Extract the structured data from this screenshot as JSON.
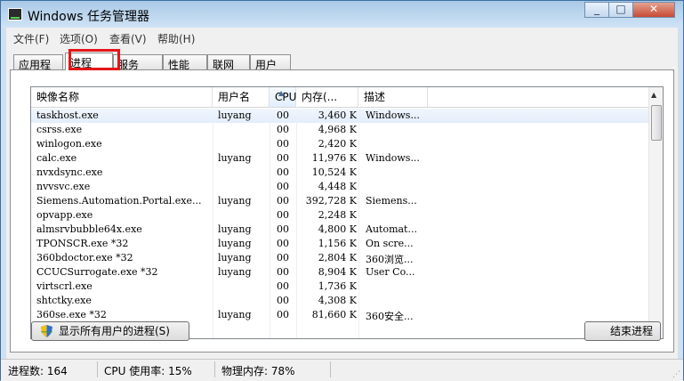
{
  "window": {
    "title": "Windows 任务管理器"
  },
  "menu": [
    "文件(F)",
    "选项(O)",
    "查看(V)",
    "帮助(H)"
  ],
  "tabs": [
    "应用程序",
    "进程",
    "服务",
    "性能",
    "联网",
    "用户"
  ],
  "active_tab": "进程",
  "columns": {
    "name": "映像名称",
    "user": "用户名",
    "cpu": "CPU",
    "mem": "内存(...",
    "desc": "描述"
  },
  "rows": [
    {
      "name": "taskhost.exe",
      "user": "luyang",
      "cpu": "00",
      "mem": "3,460 K",
      "desc": "Windows..."
    },
    {
      "name": "csrss.exe",
      "user": "",
      "cpu": "00",
      "mem": "4,968 K",
      "desc": ""
    },
    {
      "name": "winlogon.exe",
      "user": "",
      "cpu": "00",
      "mem": "2,420 K",
      "desc": ""
    },
    {
      "name": "calc.exe",
      "user": "luyang",
      "cpu": "00",
      "mem": "11,976 K",
      "desc": "Windows..."
    },
    {
      "name": "nvxdsync.exe",
      "user": "",
      "cpu": "00",
      "mem": "10,524 K",
      "desc": ""
    },
    {
      "name": "nvvsvc.exe",
      "user": "",
      "cpu": "00",
      "mem": "4,448 K",
      "desc": ""
    },
    {
      "name": "Siemens.Automation.Portal.exe...",
      "user": "luyang",
      "cpu": "00",
      "mem": "392,728 K",
      "desc": "Siemens..."
    },
    {
      "name": "opvapp.exe",
      "user": "",
      "cpu": "00",
      "mem": "2,248 K",
      "desc": ""
    },
    {
      "name": "almsrvbubble64x.exe",
      "user": "luyang",
      "cpu": "00",
      "mem": "4,800 K",
      "desc": "Automat..."
    },
    {
      "name": "TPONSCR.exe *32",
      "user": "luyang",
      "cpu": "00",
      "mem": "1,156 K",
      "desc": "On scre..."
    },
    {
      "name": "360bdoctor.exe *32",
      "user": "luyang",
      "cpu": "00",
      "mem": "2,804 K",
      "desc": "360浏览..."
    },
    {
      "name": "CCUCSurrogate.exe *32",
      "user": "luyang",
      "cpu": "00",
      "mem": "8,904 K",
      "desc": "User Co..."
    },
    {
      "name": "virtscrl.exe",
      "user": "",
      "cpu": "00",
      "mem": "1,736 K",
      "desc": ""
    },
    {
      "name": "shtctky.exe",
      "user": "",
      "cpu": "00",
      "mem": "4,308 K",
      "desc": ""
    },
    {
      "name": "360se.exe *32",
      "user": "luyang",
      "cpu": "00",
      "mem": "81,660 K",
      "desc": "360安全..."
    }
  ],
  "buttons": {
    "show_all": "显示所有用户的进程(S)",
    "end_process": "结束进程"
  },
  "status": {
    "processes": "进程数: 164",
    "cpu": "CPU 使用率: 15%",
    "memory": "物理内存: 78%"
  },
  "colors": {
    "highlight_box": "#e4161a",
    "title_gradient": "#a9c9e6"
  }
}
